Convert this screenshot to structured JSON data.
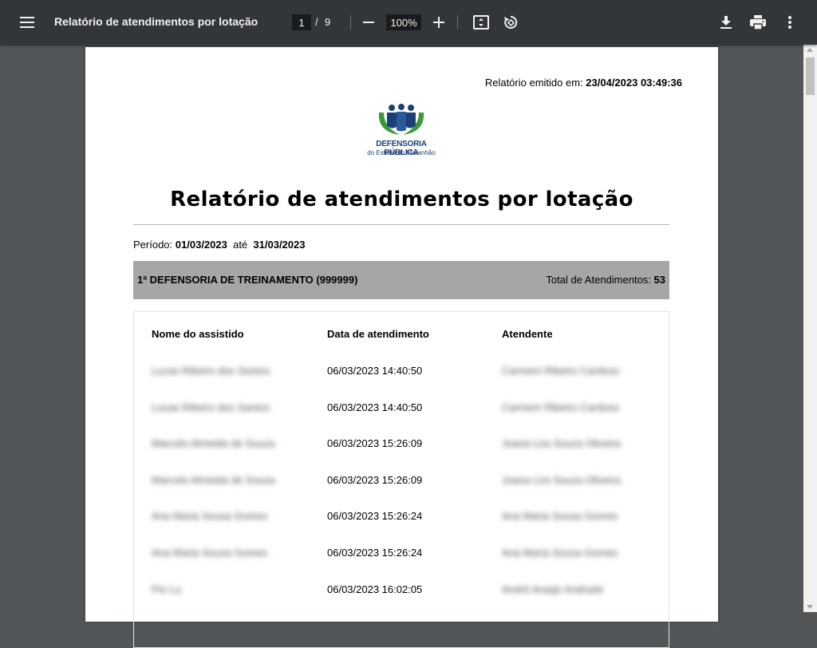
{
  "toolbar": {
    "title": "Relatório de atendimentos por lotação",
    "page_current": "1",
    "page_separator": "/",
    "page_total": "9",
    "zoom": "100%"
  },
  "document": {
    "emitted_label": "Relatório emitido em:",
    "emitted_value": "23/04/2023 03:49:36",
    "logo_line1": "DEFENSORIA PÚBLICA",
    "logo_line2": "do Estado do Maranhão",
    "title": "Relatório de atendimentos por lotação",
    "period_label": "Período:",
    "period_start": "01/03/2023",
    "period_until": "até",
    "period_end": "31/03/2023",
    "unit_name": "1ª DEFENSORIA DE TREINAMENTO (999999)",
    "total_label": "Total de Atendimentos:",
    "total_value": "53",
    "columns": [
      "Nome do assistido",
      "Data de atendimento",
      "Atendente"
    ],
    "rows": [
      {
        "name": "Lucas Ribeiro dos Santos",
        "date": "06/03/2023 14:40:50",
        "attendant": "Carmem Ribeiro Cardoso"
      },
      {
        "name": "Lucas Ribeiro dos Santos",
        "date": "06/03/2023 14:40:50",
        "attendant": "Carmem Ribeiro Cardoso"
      },
      {
        "name": "Marcelo Almeida de Souza",
        "date": "06/03/2023 15:26:09",
        "attendant": "Joana Lira Souza Oliveira"
      },
      {
        "name": "Marcelo Almeida de Souza",
        "date": "06/03/2023 15:26:09",
        "attendant": "Joana Lira Souza Oliveira"
      },
      {
        "name": "Ana Maria Sousa Gomes",
        "date": "06/03/2023 15:26:24",
        "attendant": "Ana Maria Sousa Gomes"
      },
      {
        "name": "Ana Maria Sousa Gomes",
        "date": "06/03/2023 15:26:24",
        "attendant": "Ana Maria Sousa Gomes"
      },
      {
        "name": "Pio Lu",
        "date": "06/03/2023 16:02:05",
        "attendant": "André Araújo Andrade"
      }
    ]
  },
  "icons": {
    "menu": "menu-icon",
    "zoom_out": "minus-icon",
    "zoom_in": "plus-icon",
    "fit": "fit-page-icon",
    "rotate": "rotate-icon",
    "download": "download-icon",
    "print": "print-icon",
    "more": "more-vertical-icon"
  },
  "colors": {
    "toolbar_bg": "#323639",
    "viewer_bg": "#525659",
    "unit_bar": "#a6a6a6",
    "logo_blue": "#1c3f77",
    "logo_green": "#3a9a3a"
  }
}
